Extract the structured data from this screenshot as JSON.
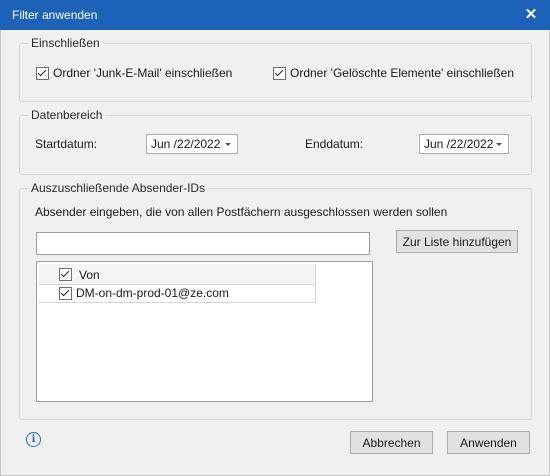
{
  "window": {
    "title": "Filter anwenden",
    "close_glyph": "✕"
  },
  "include_group": {
    "legend": "Einschließen",
    "junk_label": "Ordner 'Junk-E-Mail' einschließen",
    "junk_checked": true,
    "deleted_label": "Ordner 'Gelöschte Elemente' einschließen",
    "deleted_checked": true
  },
  "date_group": {
    "legend": "Datenbereich",
    "start_label": "Startdatum:",
    "start_value": "Jun /22/2022",
    "end_label": "Enddatum:",
    "end_value": "Jun /22/2022"
  },
  "sender_group": {
    "legend": "Auszuschließende Absender-IDs",
    "instruction": "Absender eingeben, die von allen Postfächern ausgeschlossen werden sollen",
    "input_value": "",
    "add_button": "Zur Liste hinzufügen",
    "list": {
      "header": "Von",
      "header_checked": true,
      "rows": [
        {
          "value": "DM-on-dm-prod-01@ze.com",
          "checked": true
        }
      ]
    }
  },
  "footer": {
    "info_glyph": "i",
    "cancel_button": "Abbrechen",
    "apply_button": "Anwenden"
  }
}
